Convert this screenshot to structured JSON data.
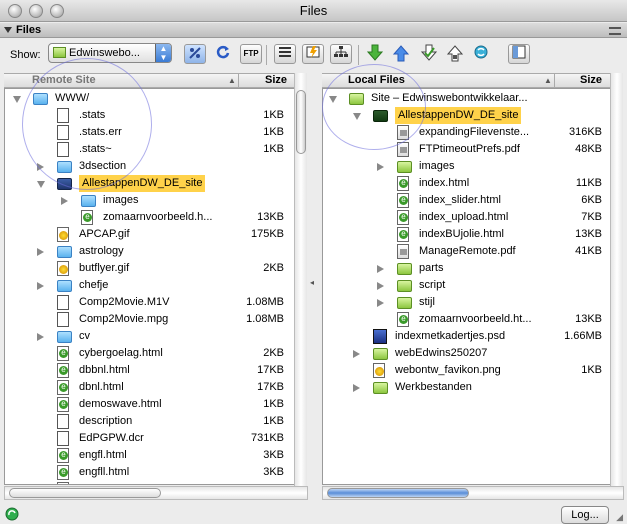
{
  "window": {
    "title": "Files"
  },
  "panel": {
    "title": "Files"
  },
  "toolbar": {
    "show_label": "Show:",
    "site_select": "Edwinswebo...",
    "buttons": [
      "connect",
      "refresh",
      "FTP",
      "site-files-view",
      "testing-server-view",
      "map-view",
      "get",
      "put",
      "check-in",
      "check-out",
      "synchronize",
      "expand"
    ],
    "ftp_text": "FTP"
  },
  "remote": {
    "header": "Remote Site",
    "size_header": "Size",
    "rows": [
      {
        "name": "WWW/",
        "size": "",
        "icon": "folder",
        "indent": 0,
        "disc": "open"
      },
      {
        "name": ".stats",
        "size": "1KB",
        "icon": "doc",
        "indent": 1,
        "disc": ""
      },
      {
        "name": ".stats.err",
        "size": "1KB",
        "icon": "doc",
        "indent": 1,
        "disc": ""
      },
      {
        "name": ".stats~",
        "size": "1KB",
        "icon": "doc",
        "indent": 1,
        "disc": ""
      },
      {
        "name": "3dsection",
        "size": "",
        "icon": "folder",
        "indent": 1,
        "disc": "closed"
      },
      {
        "name": "AllestappenDW_DE_site",
        "size": "",
        "icon": "bfolder",
        "indent": 1,
        "disc": "open",
        "hl": true
      },
      {
        "name": "images",
        "size": "",
        "icon": "folder",
        "indent": 2,
        "disc": "closed"
      },
      {
        "name": "zomaarnvoorbeeld.h...",
        "size": "13KB",
        "icon": "html",
        "indent": 2,
        "disc": ""
      },
      {
        "name": "APCAP.gif",
        "size": "175KB",
        "icon": "img",
        "indent": 1,
        "disc": ""
      },
      {
        "name": "astrology",
        "size": "",
        "icon": "folder",
        "indent": 1,
        "disc": "closed"
      },
      {
        "name": "butflyer.gif",
        "size": "2KB",
        "icon": "img",
        "indent": 1,
        "disc": ""
      },
      {
        "name": "chefje",
        "size": "",
        "icon": "folder",
        "indent": 1,
        "disc": "closed"
      },
      {
        "name": "Comp2Movie.M1V",
        "size": "1.08MB",
        "icon": "doc",
        "indent": 1,
        "disc": ""
      },
      {
        "name": "Comp2Movie.mpg",
        "size": "1.08MB",
        "icon": "doc",
        "indent": 1,
        "disc": ""
      },
      {
        "name": "cv",
        "size": "",
        "icon": "folder",
        "indent": 1,
        "disc": "closed"
      },
      {
        "name": "cybergoelag.html",
        "size": "2KB",
        "icon": "html",
        "indent": 1,
        "disc": ""
      },
      {
        "name": "dbbnl.html",
        "size": "17KB",
        "icon": "html",
        "indent": 1,
        "disc": ""
      },
      {
        "name": "dbnl.html",
        "size": "17KB",
        "icon": "html",
        "indent": 1,
        "disc": ""
      },
      {
        "name": "demoswave.html",
        "size": "1KB",
        "icon": "html",
        "indent": 1,
        "disc": ""
      },
      {
        "name": "description",
        "size": "1KB",
        "icon": "doc",
        "indent": 1,
        "disc": ""
      },
      {
        "name": "EdPGPW.dcr",
        "size": "731KB",
        "icon": "doc",
        "indent": 1,
        "disc": ""
      },
      {
        "name": "engfl.html",
        "size": "3KB",
        "icon": "html",
        "indent": 1,
        "disc": ""
      },
      {
        "name": "engfll.html",
        "size": "3KB",
        "icon": "html",
        "indent": 1,
        "disc": ""
      },
      {
        "name": "engflll.html",
        "size": "3KB",
        "icon": "html",
        "indent": 1,
        "disc": ""
      }
    ]
  },
  "local": {
    "header": "Local Files",
    "size_header": "Size",
    "rows": [
      {
        "name": "Site – Edwinswebontwikkelaar...",
        "size": "",
        "icon": "gfolder",
        "indent": 0,
        "disc": "open"
      },
      {
        "name": "AllestappenDW_DE_site",
        "size": "",
        "icon": "dfolder",
        "indent": 1,
        "disc": "open",
        "hl": true
      },
      {
        "name": "expandingFilevenste...",
        "size": "316KB",
        "icon": "pdf",
        "indent": 2,
        "disc": ""
      },
      {
        "name": "FTPtimeoutPrefs.pdf",
        "size": "48KB",
        "icon": "pdf",
        "indent": 2,
        "disc": ""
      },
      {
        "name": "images",
        "size": "",
        "icon": "gfolder",
        "indent": 2,
        "disc": "closed"
      },
      {
        "name": "index.html",
        "size": "11KB",
        "icon": "html",
        "indent": 2,
        "disc": ""
      },
      {
        "name": "index_slider.html",
        "size": "6KB",
        "icon": "html",
        "indent": 2,
        "disc": ""
      },
      {
        "name": "index_upload.html",
        "size": "7KB",
        "icon": "html",
        "indent": 2,
        "disc": ""
      },
      {
        "name": "indexBUjolie.html",
        "size": "13KB",
        "icon": "html",
        "indent": 2,
        "disc": ""
      },
      {
        "name": "ManageRemote.pdf",
        "size": "41KB",
        "icon": "pdf",
        "indent": 2,
        "disc": ""
      },
      {
        "name": "parts",
        "size": "",
        "icon": "gfolder",
        "indent": 2,
        "disc": "closed"
      },
      {
        "name": "script",
        "size": "",
        "icon": "gfolder",
        "indent": 2,
        "disc": "closed"
      },
      {
        "name": "stijl",
        "size": "",
        "icon": "gfolder",
        "indent": 2,
        "disc": "closed"
      },
      {
        "name": "zomaarnvoorbeeld.ht...",
        "size": "13KB",
        "icon": "html",
        "indent": 2,
        "disc": ""
      },
      {
        "name": "indexmetkadertjes.psd",
        "size": "1.66MB",
        "icon": "psd",
        "indent": 1,
        "disc": ""
      },
      {
        "name": "webEdwins250207",
        "size": "",
        "icon": "gfolder",
        "indent": 1,
        "disc": "closed"
      },
      {
        "name": "webontw_favikon.png",
        "size": "1KB",
        "icon": "img",
        "indent": 1,
        "disc": ""
      },
      {
        "name": "Werkbestanden",
        "size": "",
        "icon": "gfolder",
        "indent": 1,
        "disc": "closed"
      }
    ]
  },
  "status": {
    "log_label": "Log..."
  },
  "colors": {
    "highlight": "#ffd24a",
    "folder_blue": "#5ab2ee",
    "folder_green": "#8cc63f"
  }
}
